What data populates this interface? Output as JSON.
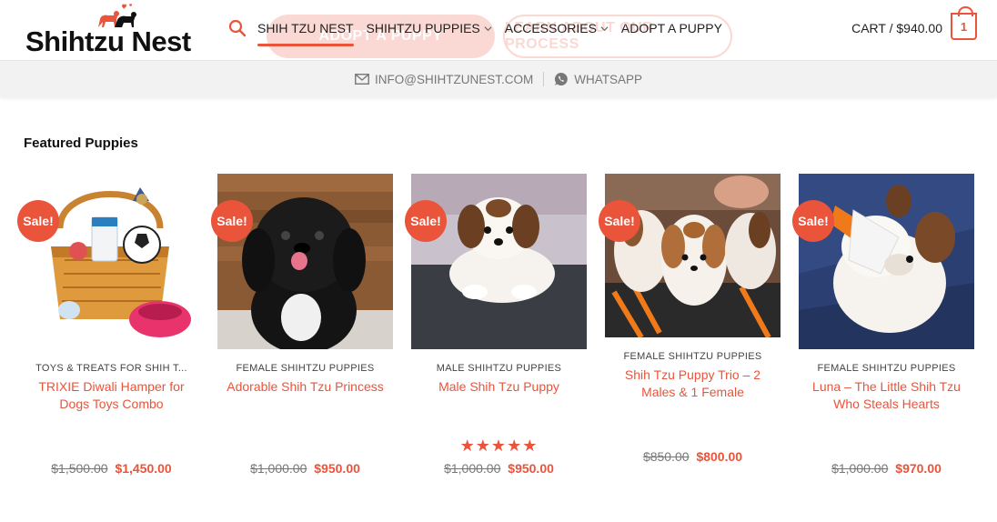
{
  "hero": {
    "adopt_button": "ADOPT A PUPPY",
    "learn_button": "LEARN ABOUT OUR PROCESS"
  },
  "header": {
    "logo_text": "Shihtzu Nest",
    "nav": [
      {
        "label": "SHIH TZU NEST",
        "active": true,
        "dropdown": false
      },
      {
        "label": "SHIHTZU PUPPIES",
        "active": false,
        "dropdown": true
      },
      {
        "label": "ACCESSORIES",
        "active": false,
        "dropdown": true
      },
      {
        "label": "ADOPT A PUPPY",
        "active": false,
        "dropdown": false
      }
    ],
    "cart_label": "CART / $940.00",
    "cart_count": "1"
  },
  "infobar": {
    "email": "INFO@SHIHTZUNEST.COM",
    "whatsapp": "WHATSAPP"
  },
  "featured": {
    "title": "Featured Puppies",
    "products": [
      {
        "badge": "Sale!",
        "category": "TOYS & TREATS FOR SHIH T...",
        "title": "TRIXIE Diwali Hamper for Dogs Toys Combo",
        "old_price": "$1,500.00",
        "new_price": "$1,450.00",
        "rating": null
      },
      {
        "badge": "Sale!",
        "category": "FEMALE SHIHTZU PUPPIES",
        "title": "Adorable Shih Tzu Princess",
        "old_price": "$1,000.00",
        "new_price": "$950.00",
        "rating": null
      },
      {
        "badge": "Sale!",
        "category": "MALE SHIHTZU PUPPIES",
        "title": "Male Shih Tzu Puppy",
        "old_price": "$1,000.00",
        "new_price": "$950.00",
        "rating": 5
      },
      {
        "badge": "Sale!",
        "category": "FEMALE SHIHTZU PUPPIES",
        "title": "Shih Tzu Puppy Trio – 2 Males & 1 Female",
        "old_price": "$850.00",
        "new_price": "$800.00",
        "rating": null
      },
      {
        "badge": "Sale!",
        "category": "FEMALE SHIHTZU PUPPIES",
        "title": "Luna – The Little Shih Tzu Who Steals Hearts",
        "old_price": "$1,000.00",
        "new_price": "$970.00",
        "rating": null
      }
    ]
  },
  "colors": {
    "accent": "#e9543a",
    "text": "#222222",
    "muted": "#777777",
    "infobar_bg": "#f2f2f2"
  }
}
